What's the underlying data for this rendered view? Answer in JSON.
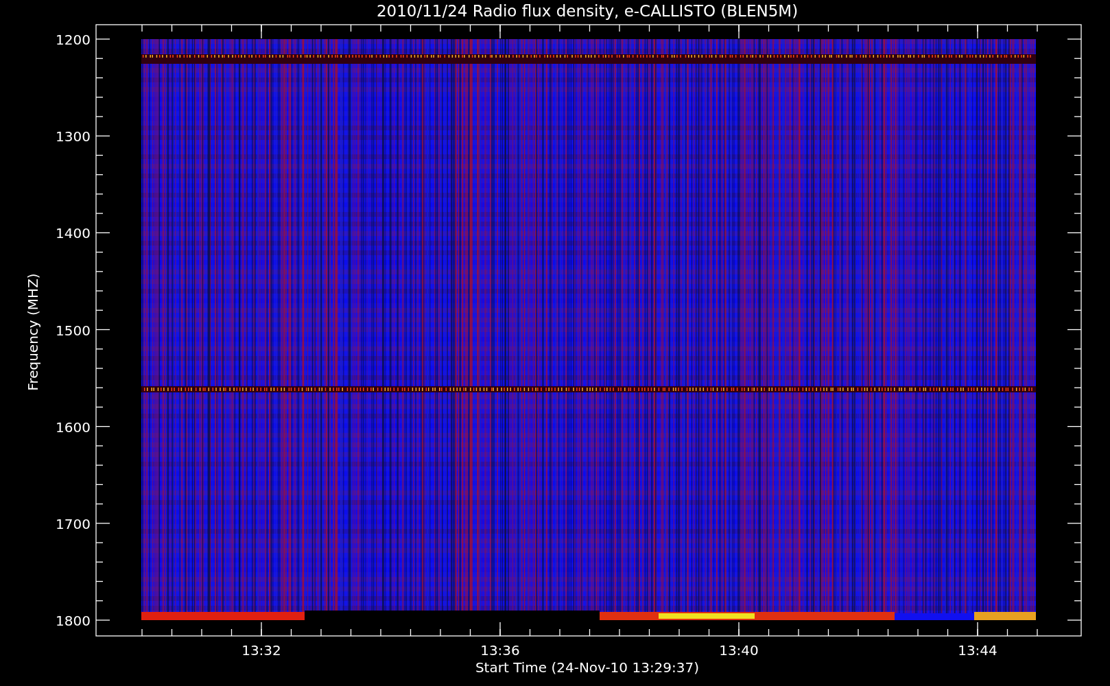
{
  "title": "2010/11/24  Radio flux density, e-CALLISTO (BLEN5M)",
  "ylabel": "Frequency (MHZ)",
  "xlabel": "Start Time (24-Nov-10 13:29:37)",
  "yticks": [
    "1200",
    "1300",
    "1400",
    "1500",
    "1600",
    "1700",
    "1800"
  ],
  "xticks": [
    "13:32",
    "13:36",
    "13:40",
    "13:44"
  ]
}
